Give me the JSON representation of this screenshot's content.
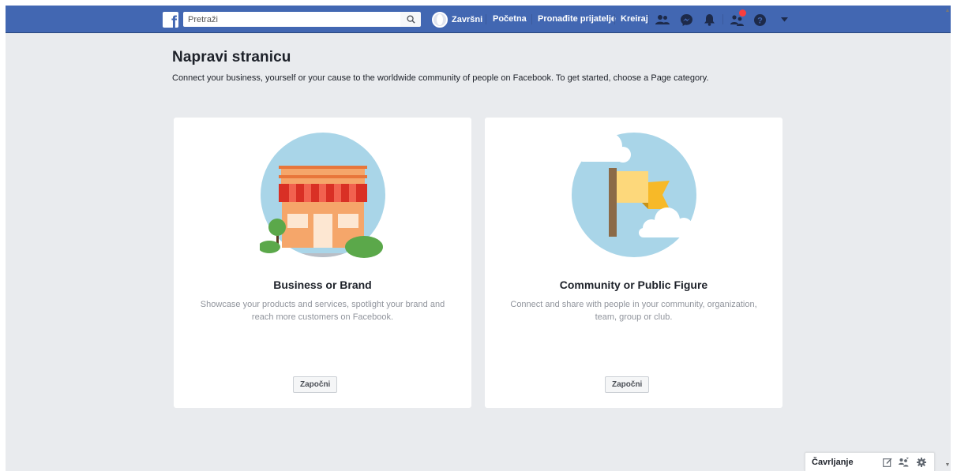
{
  "topbar": {
    "search_placeholder": "Pretraži",
    "user_name": "Završni",
    "nav_home": "Početna",
    "nav_find_friends": "Pronađite prijatelje",
    "nav_create": "Kreiraj",
    "icons": [
      "friend-requests-icon",
      "messenger-icon",
      "notifications-icon",
      "groups-icon",
      "help-icon",
      "account-menu-icon"
    ],
    "brand_color": "#4267b2"
  },
  "page": {
    "title": "Napravi stranicu",
    "subtitle": "Connect your business, yourself or your cause to the worldwide community of people on Facebook. To get started, choose a Page category."
  },
  "cards": [
    {
      "title": "Business or Brand",
      "description": "Showcase your products and services, spotlight your brand and reach more customers on Facebook.",
      "button": "Započni",
      "illustration": "storefront-icon"
    },
    {
      "title": "Community or Public Figure",
      "description": "Connect and share with people in your community, organization, team, group or club.",
      "button": "Započni",
      "illustration": "flag-icon"
    }
  ],
  "chat": {
    "label": "Čavrljanje",
    "icons": [
      "compose-icon",
      "group-chat-icon",
      "chat-settings-icon"
    ]
  }
}
